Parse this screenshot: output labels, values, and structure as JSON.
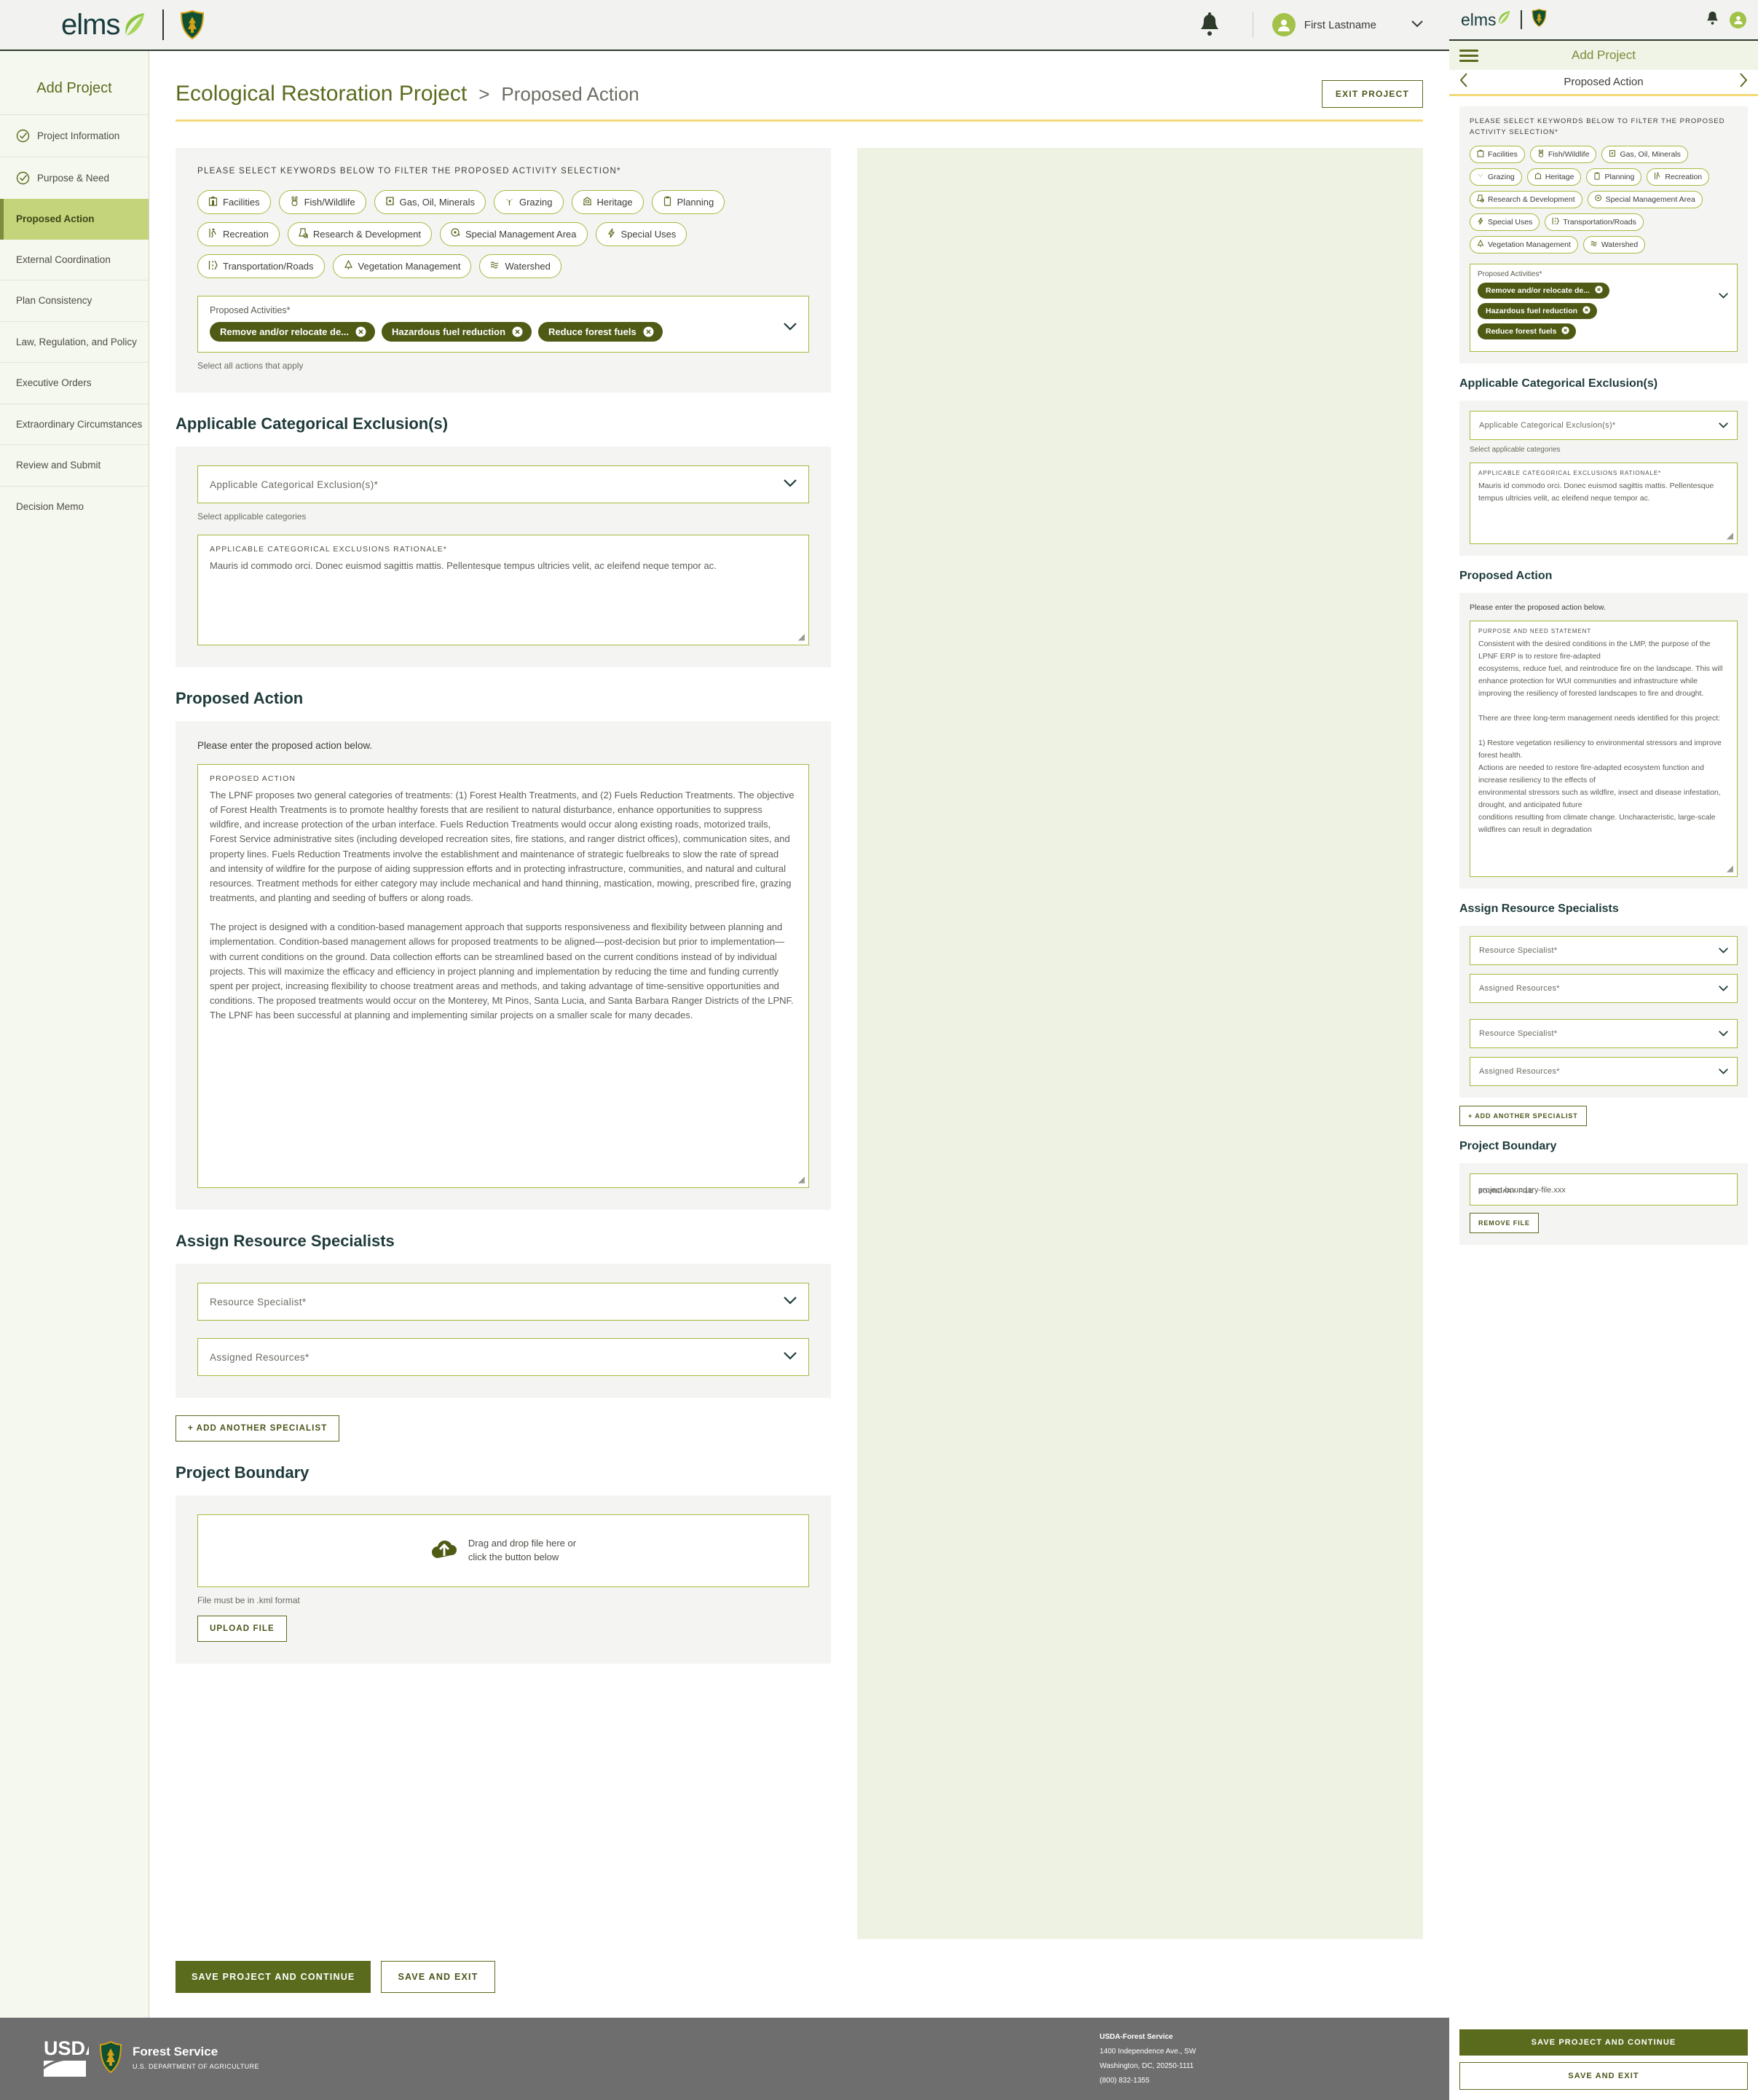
{
  "colors": {
    "brand_green": "#5b6b1e",
    "accent_lime": "#a3bb3e",
    "tag_dark": "#4f5a15",
    "gold_rule": "#f2d97a",
    "active_nav": "#c4d47a",
    "teal_heading": "#1f3a3a",
    "panel_bg": "#f4f4f2",
    "sidebar_bg": "#f5f8ef",
    "footer_bg": "#6e6e6e"
  },
  "header": {
    "brand": "elms",
    "leaf_icon": "leaf-icon",
    "agency_seal_icon": "usfs-shield-icon",
    "notifications_icon": "bell-icon",
    "avatar_icon": "user-avatar-icon",
    "user_name": "First Lastname",
    "user_caret_icon": "chevron-down-icon"
  },
  "sidebar": {
    "title": "Add Project",
    "items": [
      {
        "label": "Project Information",
        "state": "complete",
        "icon": "check-circle-icon"
      },
      {
        "label": "Purpose & Need",
        "state": "complete",
        "icon": "check-circle-icon"
      },
      {
        "label": "Proposed Action",
        "state": "active",
        "icon": ""
      },
      {
        "label": "External Coordination",
        "state": "default",
        "icon": ""
      },
      {
        "label": "Plan Consistency",
        "state": "default",
        "icon": ""
      },
      {
        "label": "Law, Regulation, and Policy",
        "state": "default",
        "icon": ""
      },
      {
        "label": "Executive Orders",
        "state": "default",
        "icon": ""
      },
      {
        "label": "Extraordinary Circumstances",
        "state": "default",
        "icon": ""
      },
      {
        "label": "Review and Submit",
        "state": "default",
        "icon": ""
      },
      {
        "label": "Decision Memo",
        "state": "default",
        "icon": ""
      }
    ]
  },
  "breadcrumb": {
    "project_name": "Ecological Restoration Project",
    "separator": ">",
    "current_step": "Proposed Action"
  },
  "exit_button": "EXIT PROJECT",
  "keywords": {
    "prompt": "PLEASE SELECT KEYWORDS BELOW TO FILTER THE PROPOSED ACTIVITY SELECTION*",
    "prompt_mobile": "PLEASE SELECT KEYWORDS BELOW TO FILTER THE PROPOSED ACTIVITY SELECTION*",
    "chips": [
      {
        "label": "Facilities",
        "icon": "building-icon"
      },
      {
        "label": "Fish/Wildlife",
        "icon": "rabbit-icon"
      },
      {
        "label": "Gas, Oil, Minerals",
        "icon": "oil-barrel-icon"
      },
      {
        "label": "Grazing",
        "icon": "grass-icon"
      },
      {
        "label": "Heritage",
        "icon": "heritage-site-icon"
      },
      {
        "label": "Planning",
        "icon": "clipboard-icon"
      },
      {
        "label": "Recreation",
        "icon": "hiker-icon"
      },
      {
        "label": "Research & Development",
        "icon": "research-flask-icon"
      },
      {
        "label": "Special Management Area",
        "icon": "map-pin-icon"
      },
      {
        "label": "Special Uses",
        "icon": "lightning-bolt-icon"
      },
      {
        "label": "Transportation/Roads",
        "icon": "road-icon"
      },
      {
        "label": "Vegetation Management",
        "icon": "tree-icon"
      },
      {
        "label": "Watershed",
        "icon": "waves-icon"
      }
    ]
  },
  "proposed_activities": {
    "label": "Proposed Activities*",
    "helper": "Select all actions that apply",
    "caret_icon": "chevron-down-icon",
    "tags": [
      {
        "label": "Remove and/or relocate de...",
        "remove_icon": "close-circle-icon"
      },
      {
        "label": "Hazardous fuel reduction",
        "remove_icon": "close-circle-icon"
      },
      {
        "label": "Reduce forest fuels",
        "remove_icon": "close-circle-icon"
      }
    ]
  },
  "categorical_exclusions": {
    "heading": "Applicable Categorical Exclusion(s)",
    "select_placeholder": "Applicable Categorical Exclusion(s)*",
    "select_caret_icon": "chevron-down-icon",
    "helper": "Select applicable categories",
    "rationale_label": "APPLICABLE CATEGORICAL EXCLUSIONS  RATIONALE*",
    "rationale_value": "Mauris id commodo orci. Donec euismod sagittis mattis. Pellentesque tempus ultricies velit, ac eleifend neque tempor ac."
  },
  "proposed_action": {
    "heading": "Proposed Action",
    "note": "Please enter the proposed action below.",
    "textarea_label": "PROPOSED ACTION",
    "textarea_value": "The LPNF proposes two general categories of treatments: (1) Forest Health Treatments, and (2) Fuels Reduction Treatments. The objective of Forest Health Treatments is to promote healthy forests that are resilient to natural disturbance, enhance opportunities to suppress wildfire, and increase protection of the urban interface. Fuels Reduction Treatments would occur along existing roads, motorized trails, Forest Service administrative sites (including developed recreation sites, fire stations, and ranger district offices), communication sites, and property lines. Fuels Reduction Treatments involve the establishment and maintenance of strategic fuelbreaks to slow the rate of spread and intensity of wildfire for the purpose of aiding suppression efforts and in protecting infrastructure, communities, and natural and cultural resources. Treatment methods for either category may include mechanical and hand thinning, mastication, mowing, prescribed fire, grazing treatments, and planting and seeding of buffers or along roads.\n\nThe project is designed with a condition-based management approach that supports responsiveness and flexibility between planning and implementation. Condition-based management allows for proposed treatments to be aligned—post-decision but prior to implementation—with current conditions on the ground. Data collection efforts can be streamlined based on the current conditions instead of by individual projects. This will maximize the efficacy and efficiency in project planning and implementation by reducing the time and funding currently spent per project, increasing flexibility to choose treatment areas and methods, and taking advantage of time-sensitive opportunities and conditions. The proposed treatments would occur on the Monterey, Mt Pinos, Santa Lucia, and Santa Barbara Ranger Districts of the LPNF. The LPNF has been successful at planning and implementing similar projects on a smaller scale for many decades."
  },
  "resource_specialists": {
    "heading": "Assign Resource Specialists",
    "specialist_placeholder": "Resource Specialist*",
    "assigned_placeholder": "Assigned Resources*",
    "add_button": "+  ADD ANOTHER SPECIALIST",
    "caret_icon": "chevron-down-icon"
  },
  "project_boundary": {
    "heading": "Project Boundary",
    "drop_icon": "cloud-upload-icon",
    "drop_line1": "Drag and drop file here or",
    "drop_line2": "click the button below",
    "format_note": "File must be in .kml format",
    "upload_button": "UPLOAD FILE"
  },
  "form_actions": {
    "save_continue": "SAVE PROJECT AND CONTINUE",
    "save_exit": "SAVE AND EXIT"
  },
  "footer": {
    "usda_logo_icon": "usda-logo-icon",
    "shield_icon": "usfs-shield-icon",
    "agency_title": "Forest Service",
    "agency_sub": "U.S. DEPARTMENT OF AGRICULTURE",
    "address": [
      "USDA-Forest Service",
      "1400 Independence Ave., SW",
      "Washington, DC, 20250-1111",
      "(800) 832-1355"
    ]
  },
  "mobile": {
    "brand": "elms",
    "menu_icon": "hamburger-menu-icon",
    "title": "Add Project",
    "prev_icon": "chevron-left-icon",
    "next_icon": "chevron-right-icon",
    "nav_title": "Proposed Action",
    "purpose_need": {
      "label": "PURPOSE AND NEED STATEMENT",
      "value": "Consistent with the desired conditions in the LMP, the purpose of the LPNF ERP is to restore fire-adapted\necosystems, reduce fuel, and reintroduce fire on the landscape. This will enhance protection for WUI communities and infrastructure while improving the resiliency of forested landscapes to fire and drought.\n\nThere are three long-term management needs identified for this project:\n\n1) Restore vegetation resiliency to environmental stressors and improve forest health.\nActions are needed to restore fire-adapted ecosystem function and increase resiliency to the effects of\nenvironmental stressors such as wildfire, insect and disease infestation, drought, and anticipated future\nconditions resulting from climate change. Uncharacteristic, large-scale wildfires can result in degradation"
    },
    "boundary_file_label": "BOUNDARY FILE",
    "boundary_file_value": "project-boundary-file.xxx",
    "remove_file_button": "REMOVE FILE"
  }
}
